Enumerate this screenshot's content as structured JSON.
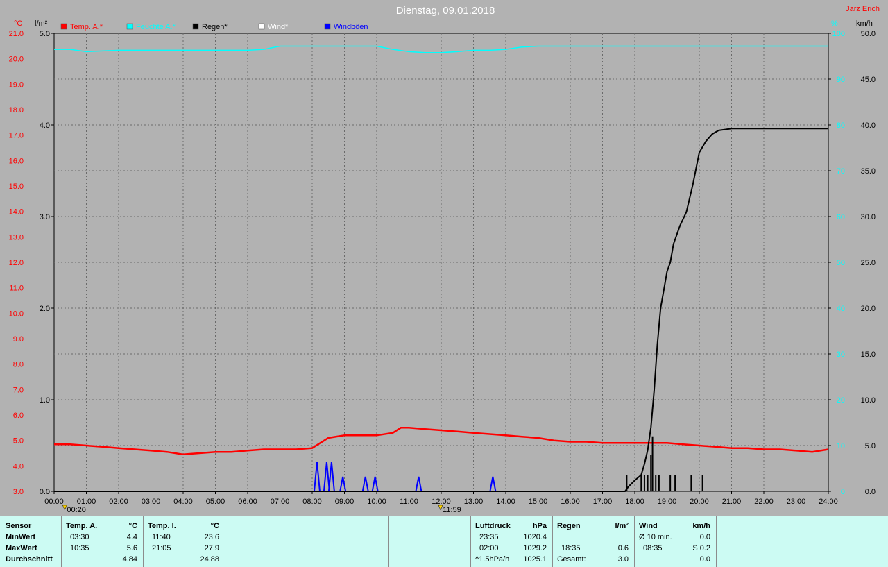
{
  "chart_data": {
    "type": "line",
    "title": "Dienstag, 09.01.2018",
    "author": "Jarz Erich",
    "x_ticks": [
      "00:00",
      "01:00",
      "02:00",
      "03:00",
      "04:00",
      "05:00",
      "06:00",
      "07:00",
      "08:00",
      "09:00",
      "10:00",
      "11:00",
      "12:00",
      "13:00",
      "14:00",
      "15:00",
      "16:00",
      "17:00",
      "18:00",
      "19:00",
      "20:00",
      "21:00",
      "22:00",
      "23:00",
      "24:00"
    ],
    "x_range_hours": [
      0,
      24
    ],
    "markers": [
      {
        "label": "00:20",
        "x": 0.33
      },
      {
        "label": "11:59",
        "x": 11.98
      }
    ],
    "axes": {
      "temp": {
        "unit": "°C",
        "ylim": [
          3.0,
          21.0
        ],
        "ticks": [
          "3.0",
          "4.0",
          "5.0",
          "6.0",
          "7.0",
          "8.0",
          "9.0",
          "10.0",
          "11.0",
          "12.0",
          "13.0",
          "14.0",
          "15.0",
          "16.0",
          "17.0",
          "18.0",
          "19.0",
          "20.0",
          "21.0"
        ]
      },
      "rain": {
        "unit": "l/m²",
        "ylim": [
          0.0,
          5.0
        ],
        "ticks": [
          "0.0",
          "1.0",
          "2.0",
          "3.0",
          "4.0",
          "5.0"
        ]
      },
      "humidity": {
        "unit": "%",
        "ylim": [
          0,
          100
        ],
        "ticks": [
          "0",
          "10",
          "20",
          "30",
          "40",
          "50",
          "60",
          "70",
          "80",
          "90",
          "100"
        ]
      },
      "wind": {
        "unit": "km/h",
        "ylim": [
          0.0,
          50.0
        ],
        "ticks": [
          "0.0",
          "5.0",
          "10.0",
          "15.0",
          "20.0",
          "25.0",
          "30.0",
          "35.0",
          "40.0",
          "45.0",
          "50.0"
        ]
      }
    },
    "legend": [
      {
        "name": "Temp. A.*",
        "color": "#ff0000"
      },
      {
        "name": "Feuchte A.*",
        "color": "#00ffff"
      },
      {
        "name": "Regen*",
        "color": "#000000"
      },
      {
        "name": "Wind*",
        "color": "#ffffff"
      },
      {
        "name": "Windböen",
        "color": "#0000ff"
      }
    ],
    "grid": true,
    "series": [
      {
        "name": "Temp. A.*",
        "color": "#ff0000",
        "axis": "temp",
        "x": [
          0,
          0.5,
          1,
          1.5,
          2,
          2.5,
          3,
          3.5,
          4,
          4.5,
          5,
          5.5,
          6,
          6.5,
          7,
          7.5,
          8,
          8.25,
          8.5,
          9,
          9.5,
          10,
          10.5,
          10.75,
          11,
          11.5,
          12,
          12.5,
          13,
          13.5,
          14,
          14.5,
          15,
          15.5,
          16,
          16.5,
          17,
          17.5,
          18,
          18.5,
          19,
          19.5,
          20,
          20.5,
          21,
          21.5,
          22,
          22.5,
          23,
          23.5,
          24
        ],
        "y": [
          4.85,
          4.85,
          4.8,
          4.75,
          4.7,
          4.65,
          4.6,
          4.55,
          4.45,
          4.5,
          4.55,
          4.55,
          4.6,
          4.65,
          4.65,
          4.65,
          4.7,
          4.9,
          5.1,
          5.2,
          5.2,
          5.2,
          5.3,
          5.5,
          5.5,
          5.45,
          5.4,
          5.35,
          5.3,
          5.25,
          5.2,
          5.15,
          5.1,
          5.0,
          4.95,
          4.95,
          4.9,
          4.9,
          4.9,
          4.9,
          4.9,
          4.85,
          4.8,
          4.75,
          4.7,
          4.7,
          4.65,
          4.65,
          4.6,
          4.55,
          4.65
        ]
      },
      {
        "name": "Feuchte A.*",
        "color": "#00ffff",
        "axis": "humidity",
        "x": [
          0,
          0.5,
          1,
          2,
          3,
          4,
          5,
          6,
          6.5,
          7,
          8,
          9,
          9.5,
          10,
          10.5,
          11,
          11.5,
          12,
          12.5,
          13,
          13.5,
          14,
          14.5,
          15,
          16,
          17,
          18,
          19,
          20,
          21,
          22,
          23,
          24
        ],
        "y": [
          96.5,
          96.5,
          96,
          96.3,
          96.3,
          96.3,
          96.3,
          96.3,
          96.5,
          97.2,
          97.2,
          97.2,
          97.2,
          97.2,
          96.5,
          96,
          95.8,
          95.8,
          96,
          96.3,
          96.3,
          96.5,
          97,
          97.2,
          97.2,
          97.2,
          97.2,
          97.2,
          97.2,
          97.2,
          97.2,
          97.2,
          97.2
        ]
      },
      {
        "name": "Regen*",
        "color": "#000000",
        "axis": "rain",
        "x": [
          0,
          17.7,
          17.8,
          18.0,
          18.2,
          18.3,
          18.4,
          18.5,
          18.6,
          18.7,
          18.8,
          18.9,
          19.0,
          19.1,
          19.2,
          19.4,
          19.6,
          19.8,
          20.0,
          20.2,
          20.4,
          20.6,
          20.8,
          21.0,
          21.5,
          22,
          23,
          24
        ],
        "y": [
          0,
          0,
          0.05,
          0.12,
          0.18,
          0.3,
          0.45,
          0.7,
          1.1,
          1.6,
          2.0,
          2.2,
          2.4,
          2.5,
          2.7,
          2.9,
          3.05,
          3.35,
          3.7,
          3.82,
          3.9,
          3.94,
          3.95,
          3.96,
          3.96,
          3.96,
          3.96,
          3.96
        ]
      },
      {
        "name": "Windböen",
        "color": "#0000ff",
        "axis": "wind",
        "peaks": [
          {
            "x": 8.15,
            "v": 3.2
          },
          {
            "x": 8.45,
            "v": 3.2
          },
          {
            "x": 8.6,
            "v": 3.2
          },
          {
            "x": 8.95,
            "v": 1.6
          },
          {
            "x": 9.65,
            "v": 1.6
          },
          {
            "x": 9.95,
            "v": 1.6
          },
          {
            "x": 11.3,
            "v": 1.6
          },
          {
            "x": 13.6,
            "v": 1.6
          }
        ]
      },
      {
        "name": "Regen (Intervall)",
        "color": "#000000",
        "axis": "rain",
        "type": "bars",
        "x": [
          17.75,
          18.2,
          18.3,
          18.4,
          18.5,
          18.55,
          18.65,
          18.75,
          19.1,
          19.25,
          19.75,
          20.1
        ],
        "y": [
          0.18,
          0.18,
          0.18,
          0.18,
          0.4,
          0.6,
          0.18,
          0.18,
          0.18,
          0.18,
          0.18,
          0.18
        ]
      }
    ]
  },
  "stats": {
    "sensor_header": "Sensor",
    "rows": [
      "MinWert",
      "MaxWert",
      "Durchschnitt"
    ],
    "temp_a": {
      "title": "Temp. A.",
      "unit": "°C",
      "min_time": "03:30",
      "min_val": "4.4",
      "max_time": "10:35",
      "max_val": "5.6",
      "avg": "4.84"
    },
    "temp_i": {
      "title": "Temp. I.",
      "unit": "°C",
      "min_time": "11:40",
      "min_val": "23.6",
      "max_time": "21:05",
      "max_val": "27.9",
      "avg": "24.88"
    },
    "luftdruck": {
      "title": "Luftdruck",
      "unit": "hPa",
      "min_time": "23:35",
      "min_val": "1020.4",
      "max_time": "02:00",
      "max_val": "1029.2",
      "avg_label": "^1.5hPa/h",
      "avg": "1025.1"
    },
    "regen": {
      "title": "Regen",
      "unit": "l/m²",
      "max_time": "18:35",
      "max_val": "0.6",
      "total_label": "Gesamt:",
      "total": "3.0"
    },
    "wind": {
      "title": "Wind",
      "unit": "km/h",
      "min_label": "Ø 10 min.",
      "min_val": "0.0",
      "max_time": "08:35",
      "max_dir": "S 0.2",
      "avg": "0.0"
    }
  }
}
